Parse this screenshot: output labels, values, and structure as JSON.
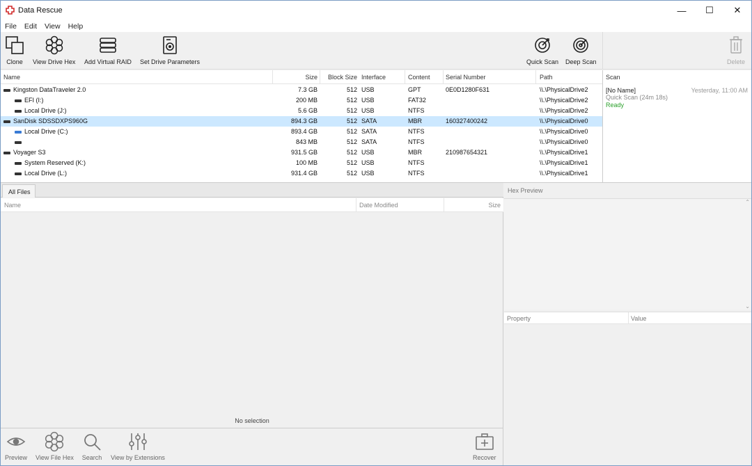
{
  "window": {
    "title": "Data Rescue",
    "minimize": "—",
    "maximize": "☐",
    "close": "✕"
  },
  "menu": [
    "File",
    "Edit",
    "View",
    "Help"
  ],
  "toolbar": {
    "clone": "Clone",
    "view_drive_hex": "View Drive Hex",
    "add_virtual_raid": "Add Virtual RAID",
    "set_drive_parameters": "Set Drive Parameters",
    "quick_scan": "Quick Scan",
    "deep_scan": "Deep Scan",
    "delete": "Delete"
  },
  "drives": {
    "columns": [
      "Name",
      "Size",
      "Block Size",
      "Interface",
      "Content",
      "Serial Number",
      "Path"
    ],
    "rows": [
      {
        "name": "Kingston DataTraveler 2.0",
        "size": "7.3 GB",
        "block": "512",
        "iface": "USB",
        "content": "GPT",
        "serial": "0E0D1280F631",
        "path": "\\\\.\\PhysicalDrive2"
      },
      {
        "name": "EFI (I:)",
        "size": "200 MB",
        "block": "512",
        "iface": "USB",
        "content": "FAT32",
        "serial": "",
        "path": "\\\\.\\PhysicalDrive2"
      },
      {
        "name": "Local Drive (J:)",
        "size": "5.6 GB",
        "block": "512",
        "iface": "USB",
        "content": "NTFS",
        "serial": "",
        "path": "\\\\.\\PhysicalDrive2"
      },
      {
        "name": "SanDisk SDSSDXPS960G",
        "size": "894.3 GB",
        "block": "512",
        "iface": "SATA",
        "content": "MBR",
        "serial": "160327400242",
        "path": "\\\\.\\PhysicalDrive0"
      },
      {
        "name": "Local Drive (C:)",
        "size": "893.4 GB",
        "block": "512",
        "iface": "SATA",
        "content": "NTFS",
        "serial": "",
        "path": "\\\\.\\PhysicalDrive0"
      },
      {
        "name": "",
        "size": "843 MB",
        "block": "512",
        "iface": "SATA",
        "content": "NTFS",
        "serial": "",
        "path": "\\\\.\\PhysicalDrive0"
      },
      {
        "name": "Voyager S3",
        "size": "931.5 GB",
        "block": "512",
        "iface": "USB",
        "content": "MBR",
        "serial": "210987654321",
        "path": "\\\\.\\PhysicalDrive1"
      },
      {
        "name": "System Reserved (K:)",
        "size": "100 MB",
        "block": "512",
        "iface": "USB",
        "content": "NTFS",
        "serial": "",
        "path": "\\\\.\\PhysicalDrive1"
      },
      {
        "name": "Local Drive (L:)",
        "size": "931.4 GB",
        "block": "512",
        "iface": "USB",
        "content": "NTFS",
        "serial": "",
        "path": "\\\\.\\PhysicalDrive1"
      }
    ]
  },
  "scan": {
    "header": "Scan",
    "entry_name": "[No Name]",
    "entry_time": "Yesterday, 11:00 AM",
    "entry_detail": "Quick Scan (24m 18s)",
    "entry_status": "Ready",
    "status_color": "#2aa02a"
  },
  "files": {
    "tab": "All Files",
    "columns": [
      "Name",
      "Date Modified",
      "Size"
    ],
    "status": "No selection"
  },
  "hex": {
    "header": "Hex Preview"
  },
  "properties": {
    "columns": [
      "Property",
      "Value"
    ]
  },
  "bottom": {
    "preview": "Preview",
    "view_file_hex": "View File Hex",
    "search": "Search",
    "view_by_extensions": "View by Extensions",
    "recover": "Recover"
  }
}
